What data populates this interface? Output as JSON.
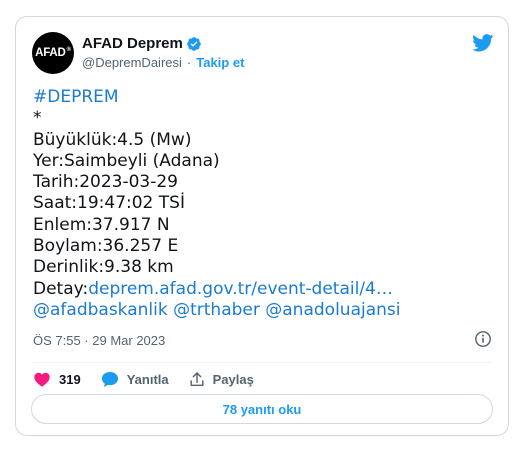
{
  "tweet": {
    "avatar_text": "AFAD",
    "display_name": "AFAD Deprem",
    "handle": "@DepremDairesi",
    "separator": "·",
    "follow_label": "Takip et",
    "body_lines": [
      {
        "type": "link",
        "text": "#DEPREM"
      },
      {
        "type": "text",
        "text": "*"
      },
      {
        "type": "text",
        "text": "Büyüklük:4.5 (Mw)"
      },
      {
        "type": "text",
        "text": "Yer:Saimbeyli (Adana)"
      },
      {
        "type": "text",
        "text": "Tarih:2023-03-29"
      },
      {
        "type": "text",
        "text": "Saat:19:47:02 TSİ"
      },
      {
        "type": "text",
        "text": "Enlem:37.917 N"
      },
      {
        "type": "text",
        "text": "Boylam:36.257 E"
      },
      {
        "type": "text",
        "text": "Derinlik:9.38 km"
      },
      {
        "type": "detay",
        "text": "Detay:",
        "link": "deprem.afad.gov.tr/event-detail/4…"
      },
      {
        "type": "link",
        "text": "@afadbaskanlik @trthaber @anadoluajansi"
      }
    ],
    "timestamp": "ÖS 7:55 · 29 Mar 2023",
    "like_count": "319",
    "reply_label": "Yanıtla",
    "share_label": "Paylaş",
    "read_replies_label": "78 yanıtı oku"
  },
  "colors": {
    "accent": "#1d9bf0",
    "link": "#1b7bd3",
    "like": "#f91880",
    "muted": "#536471",
    "border": "#cfd9de"
  }
}
